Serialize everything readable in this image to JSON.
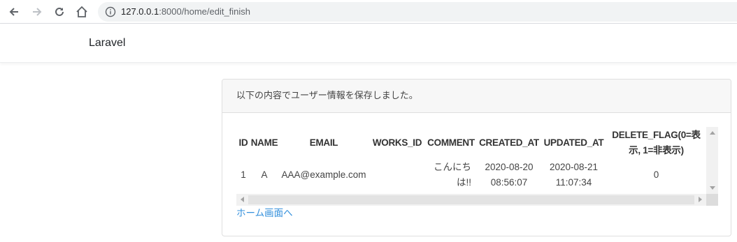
{
  "browser": {
    "url_host": "127.0.0.1",
    "url_rest": ":8000/home/edit_finish"
  },
  "navbar": {
    "brand": "Laravel"
  },
  "card": {
    "header": "以下の内容でユーザー情報を保存しました。",
    "table": {
      "headers": [
        "ID",
        "NAME",
        "EMAIL",
        "WORKS_ID",
        "COMMENT",
        "CREATED_AT",
        "UPDATED_AT",
        "DELETE_FLAG(0=表示, 1=非表示)"
      ],
      "rows": [
        [
          "1",
          "A",
          "AAA@example.com",
          "",
          "こんにちは!!",
          "2020-08-20 08:56:07",
          "2020-08-21 11:07:34",
          "0"
        ]
      ]
    },
    "home_link": "ホーム画面へ"
  }
}
